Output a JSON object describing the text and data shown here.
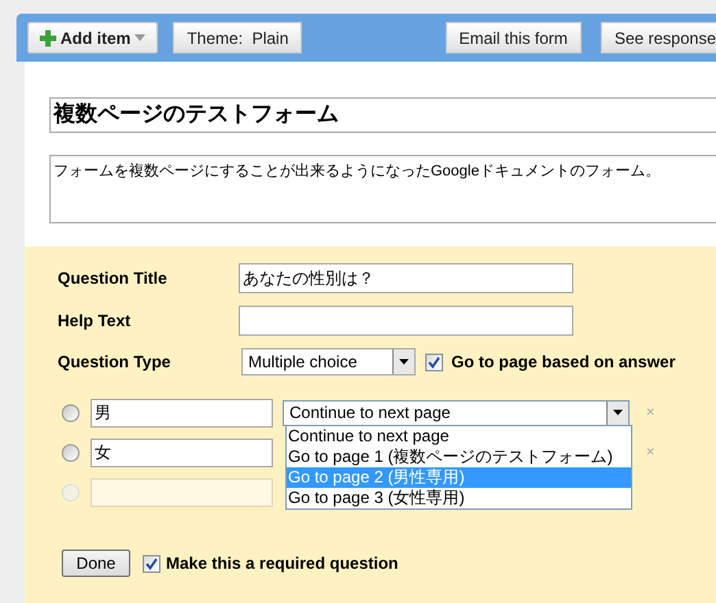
{
  "toolbar": {
    "add_item": "Add item",
    "buttons_left": [
      "Theme:  Plain"
    ],
    "buttons_right": [
      "Email this form",
      "See response"
    ]
  },
  "form": {
    "title": "複数ページのテストフォーム",
    "description": "フォームを複数ページにすることが出来るようになったGoogleドキュメントのフォーム。"
  },
  "question": {
    "title_label": "Question Title",
    "title_value": "あなたの性別は？",
    "help_label": "Help Text",
    "type_label": "Question Type",
    "type_value": "Multiple choice",
    "go_to_page": {
      "label": "Go to page based on answer",
      "checked": true
    },
    "choices": [
      {
        "kind": "option",
        "checked": false,
        "value": "男",
        "page": "Continue to next page",
        "remove": "×"
      },
      {
        "kind": "option",
        "checked": false,
        "value": "女",
        "remove": "×"
      },
      {
        "kind": "blank",
        "checked": false
      }
    ],
    "page_dropdown_open": true,
    "dropdown_options": [
      {
        "label": "Continue to next page",
        "selected": false
      },
      {
        "label": "Go to page 1 (複数ページのテストフォーム)",
        "selected": false
      },
      {
        "label": "Go to page 2 (男性専用)",
        "selected": true
      },
      {
        "label": "Go to page 3 (女性専用)",
        "selected": false
      }
    ],
    "done": "Done",
    "required": {
      "label": "Make this a required question",
      "checked": true
    }
  }
}
